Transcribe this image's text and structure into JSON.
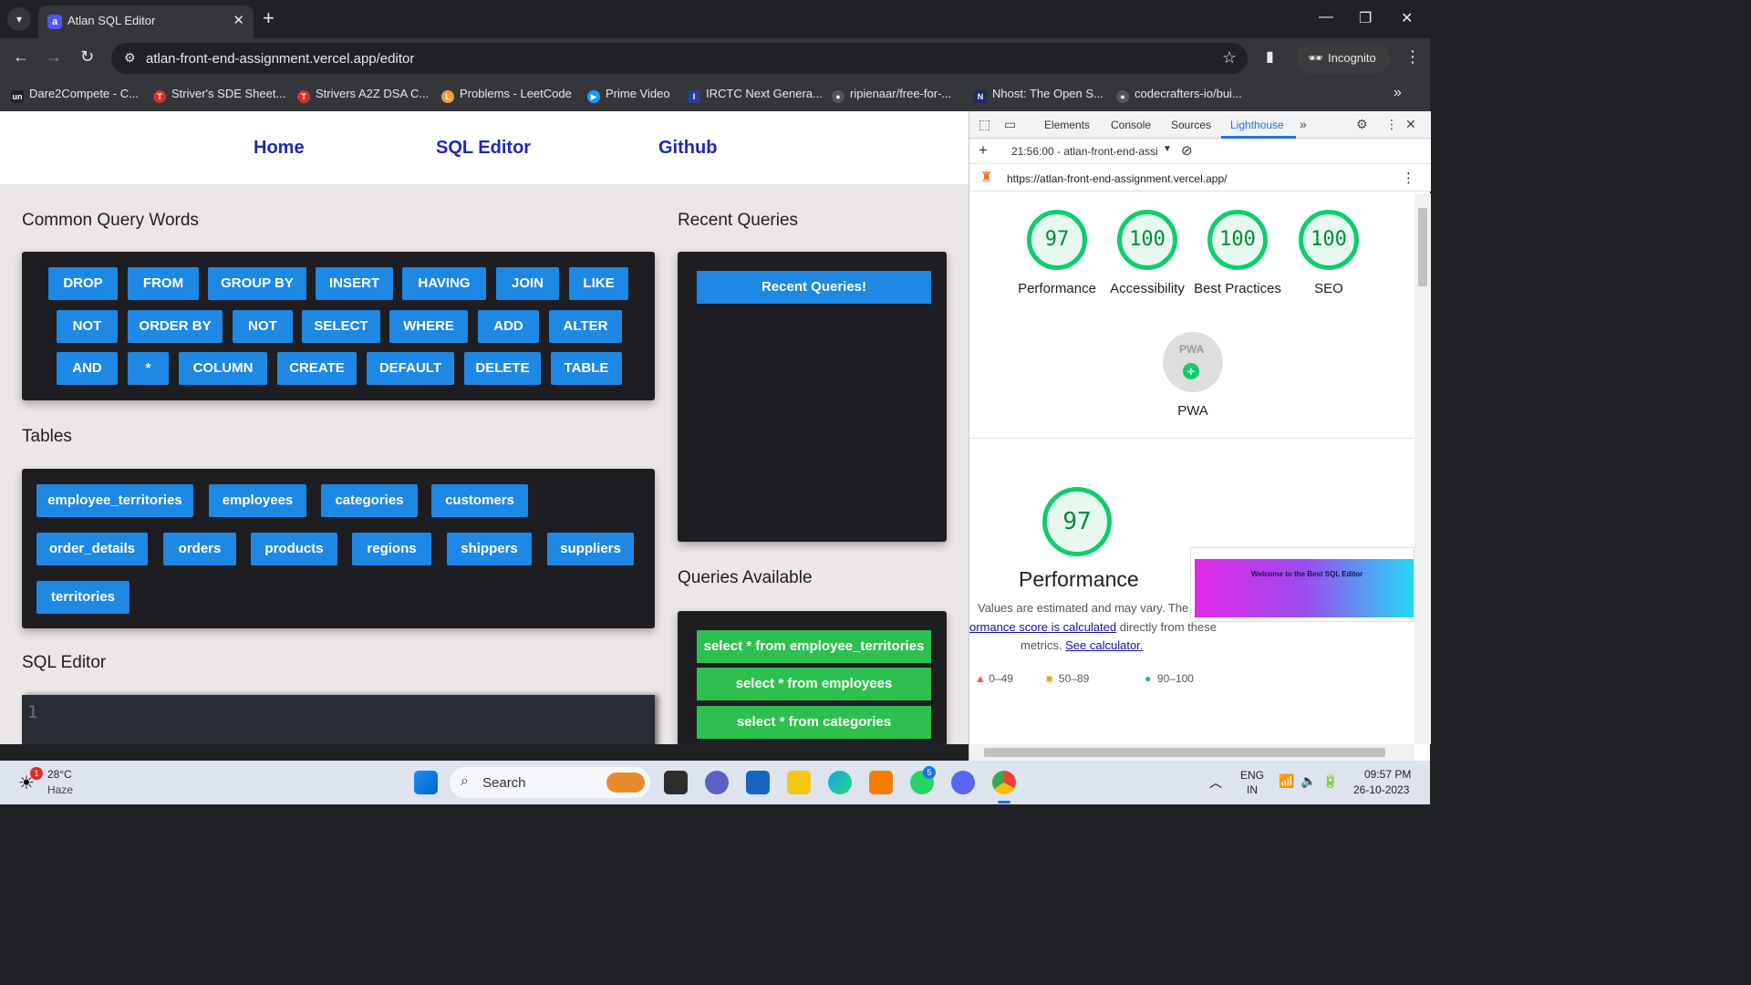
{
  "browser": {
    "tab_title": "Atlan SQL Editor",
    "url": "atlan-front-end-assignment.vercel.app/editor",
    "incognito_label": "Incognito",
    "bookmarks": [
      "Dare2Compete - C...",
      "Striver's SDE Sheet...",
      "Strivers A2Z DSA C...",
      "Problems - LeetCode",
      "Prime Video",
      "IRCTC Next Genera...",
      "ripienaar/free-for-...",
      "Nhost: The Open S...",
      "codecrafters-io/bui..."
    ]
  },
  "nav": {
    "home": "Home",
    "sql_editor": "SQL Editor",
    "github": "Github"
  },
  "common_words": {
    "title": "Common Query Words",
    "rows": [
      [
        "DROP",
        "FROM",
        "GROUP BY",
        "INSERT",
        "HAVING",
        "JOIN",
        "LIKE"
      ],
      [
        "NOT",
        "ORDER BY",
        "NOT",
        "SELECT",
        "WHERE",
        "ADD",
        "ALTER"
      ],
      [
        "AND",
        "*",
        "COLUMN",
        "CREATE",
        "DEFAULT",
        "DELETE",
        "TABLE"
      ]
    ]
  },
  "tables": {
    "title": "Tables",
    "rows": [
      [
        "employee_territories",
        "employees",
        "categories",
        "customers"
      ],
      [
        "order_details",
        "orders",
        "products",
        "regions",
        "shippers",
        "suppliers"
      ],
      [
        "territories"
      ]
    ]
  },
  "sql_editor": {
    "title": "SQL Editor",
    "line_number": "1"
  },
  "recent": {
    "title": "Recent Queries",
    "button": "Recent Queries!"
  },
  "queries_available": {
    "title": "Queries Available",
    "items": [
      "select * from employee_territories",
      "select * from employees",
      "select * from categories"
    ]
  },
  "devtools": {
    "tabs": [
      "Elements",
      "Console",
      "Sources",
      "Lighthouse"
    ],
    "report_time": "21:56:00 - atlan-front-end-assi",
    "report_url": "https://atlan-front-end-assignment.vercel.app/",
    "scores": [
      {
        "value": "97",
        "label": "Performance"
      },
      {
        "value": "100",
        "label": "Accessibility"
      },
      {
        "value": "100",
        "label": "Best Practices"
      },
      {
        "value": "100",
        "label": "SEO"
      }
    ],
    "pwa_label": "PWA",
    "pwa_badge": "PWA",
    "perf_score": "97",
    "perf_title": "Performance",
    "perf_note_1": "Values are estimated and may vary. The",
    "perf_note_link": "ormance score is calculated",
    "perf_note_2": "directly from these",
    "perf_note_3": "metrics.",
    "perf_note_calc": "See calculator.",
    "legend": [
      "0–49",
      "50–89",
      "90–100"
    ],
    "thumb_title": "Welcome to the Best SQL Editor"
  },
  "taskbar": {
    "weather_temp": "28°C",
    "weather_desc": "Haze",
    "weather_badge": "1",
    "search_label": "Search",
    "lang_1": "ENG",
    "lang_2": "IN",
    "time": "09:57 PM",
    "date": "26-10-2023",
    "whatsapp_badge": "5"
  },
  "colors": {
    "keyword_blue": "#1e88e5",
    "query_green": "#2ec04f",
    "panel_dark": "#1e1d22",
    "nav_link": "#1d29b8",
    "score_green": "#0cce6b"
  }
}
